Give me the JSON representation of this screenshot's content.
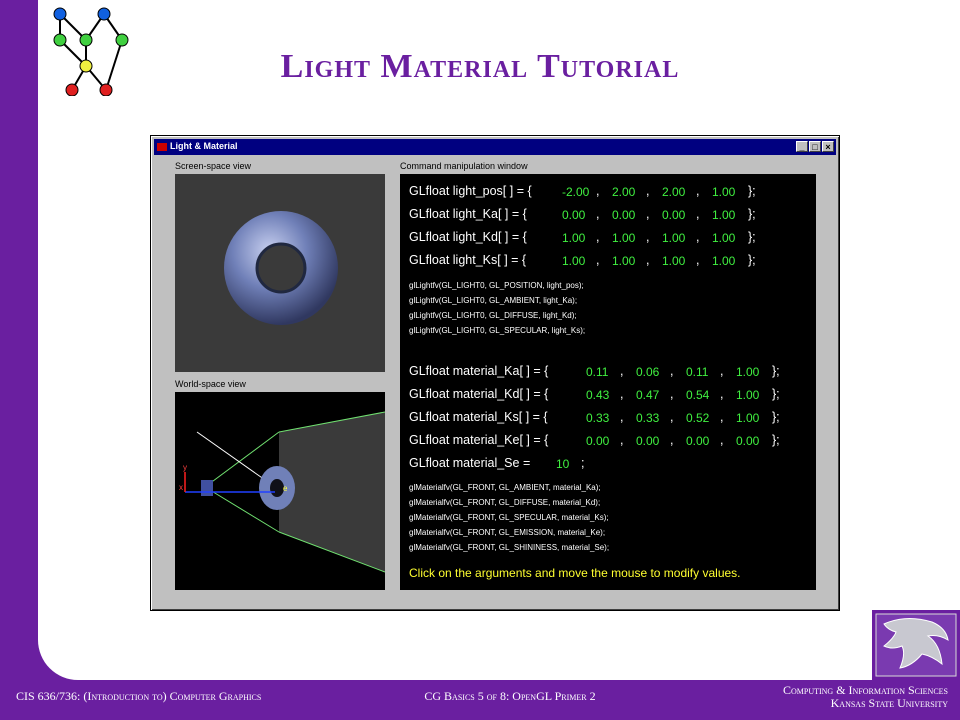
{
  "slide": {
    "title": "Light Material Tutorial",
    "footer_left": "CIS 636/736: (Introduction to) Computer Graphics",
    "footer_center": "CG Basics 5 of 8: OpenGL Primer 2",
    "footer_right_1": "Computing & Information Sciences",
    "footer_right_2": "Kansas State University",
    "colors": {
      "purple": "#6a1fa0",
      "code_value": "#40f040",
      "hint": "#ffff30"
    }
  },
  "window": {
    "title": "Light & Material",
    "minimize_label": "_",
    "maximize_label": "□",
    "close_label": "×",
    "screen_label": "Screen-space view",
    "world_label": "World-space view",
    "command_label": "Command manipulation window"
  },
  "world_axes": {
    "y": "y",
    "x": "x",
    "e": "e"
  },
  "light_rows": [
    {
      "prefix": "GLfloat light_pos[ ] = {",
      "values": [
        "-2.00",
        "2.00",
        "2.00",
        "1.00"
      ]
    },
    {
      "prefix": "GLfloat light_Ka[ ] = {",
      "values": [
        "0.00",
        "0.00",
        "0.00",
        "1.00"
      ]
    },
    {
      "prefix": "GLfloat light_Kd[ ] = {",
      "values": [
        "1.00",
        "1.00",
        "1.00",
        "1.00"
      ]
    },
    {
      "prefix": "GLfloat light_Ks[ ] = {",
      "values": [
        "1.00",
        "1.00",
        "1.00",
        "1.00"
      ]
    }
  ],
  "light_calls": [
    "glLightfv(GL_LIGHT0, GL_POSITION, light_pos);",
    "glLightfv(GL_LIGHT0, GL_AMBIENT, light_Ka);",
    "glLightfv(GL_LIGHT0, GL_DIFFUSE, light_Kd);",
    "glLightfv(GL_LIGHT0, GL_SPECULAR, light_Ks);"
  ],
  "material_rows": [
    {
      "prefix": "GLfloat material_Ka[ ] = {",
      "values": [
        "0.11",
        "0.06",
        "0.11",
        "1.00"
      ]
    },
    {
      "prefix": "GLfloat material_Kd[ ] = {",
      "values": [
        "0.43",
        "0.47",
        "0.54",
        "1.00"
      ]
    },
    {
      "prefix": "GLfloat material_Ks[ ] = {",
      "values": [
        "0.33",
        "0.33",
        "0.52",
        "1.00"
      ]
    },
    {
      "prefix": "GLfloat material_Ke[ ] = {",
      "values": [
        "0.00",
        "0.00",
        "0.00",
        "0.00"
      ]
    }
  ],
  "material_se": {
    "prefix": "GLfloat material_Se =",
    "value": "10",
    "suffix": ";"
  },
  "material_calls": [
    "glMaterialfv(GL_FRONT, GL_AMBIENT, material_Ka);",
    "glMaterialfv(GL_FRONT, GL_DIFFUSE, material_Kd);",
    "glMaterialfv(GL_FRONT, GL_SPECULAR, material_Ks);",
    "glMaterialfv(GL_FRONT, GL_EMISSION, material_Ke);",
    "glMaterialfv(GL_FRONT, GL_SHININESS, material_Se);"
  ],
  "hint": "Click on the arguments and move the mouse to modify values.",
  "row_close": "};"
}
